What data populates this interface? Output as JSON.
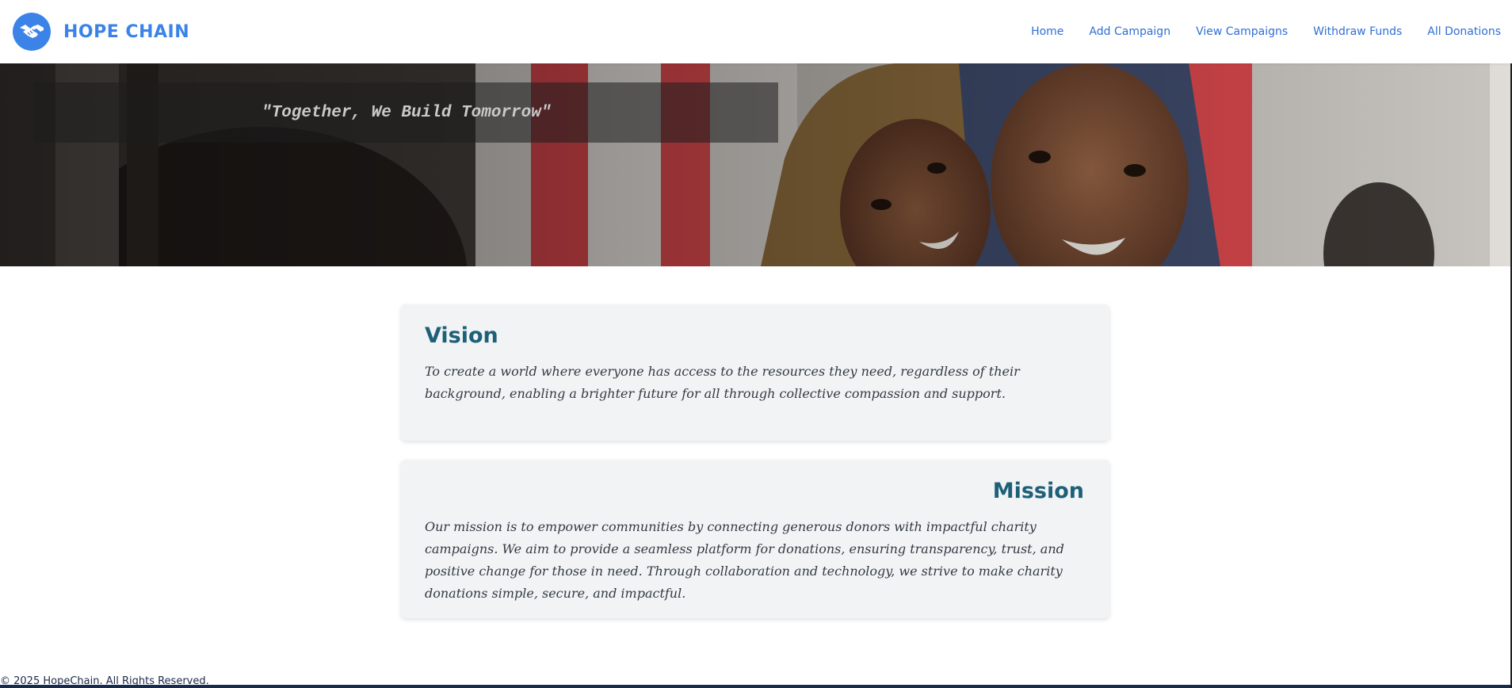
{
  "brand": {
    "name": "HOPE CHAIN",
    "logo_icon": "handshake-icon",
    "accent_color": "#3c83e8"
  },
  "nav": {
    "items": [
      {
        "label": "Home"
      },
      {
        "label": "Add Campaign"
      },
      {
        "label": "View Campaigns"
      },
      {
        "label": "Withdraw Funds"
      },
      {
        "label": "All Donations"
      }
    ]
  },
  "hero": {
    "quote": "\"Together, We Build Tomorrow\"",
    "image": "children-smiling-photo"
  },
  "vision": {
    "title": "Vision",
    "text": "To create a world where everyone has access to the resources they need, regardless of their background, enabling a brighter future for all through collective compassion and support."
  },
  "mission": {
    "title": "Mission",
    "text": "Our mission is to empower communities by connecting generous donors with impactful charity campaigns. We aim to provide a seamless platform for donations, ensuring transparency, trust, and positive change for those in need. Through collaboration and technology, we strive to make charity donations simple, secure, and impactful."
  },
  "footer": {
    "text": "© 2025 HopeChain. All Rights Reserved."
  }
}
